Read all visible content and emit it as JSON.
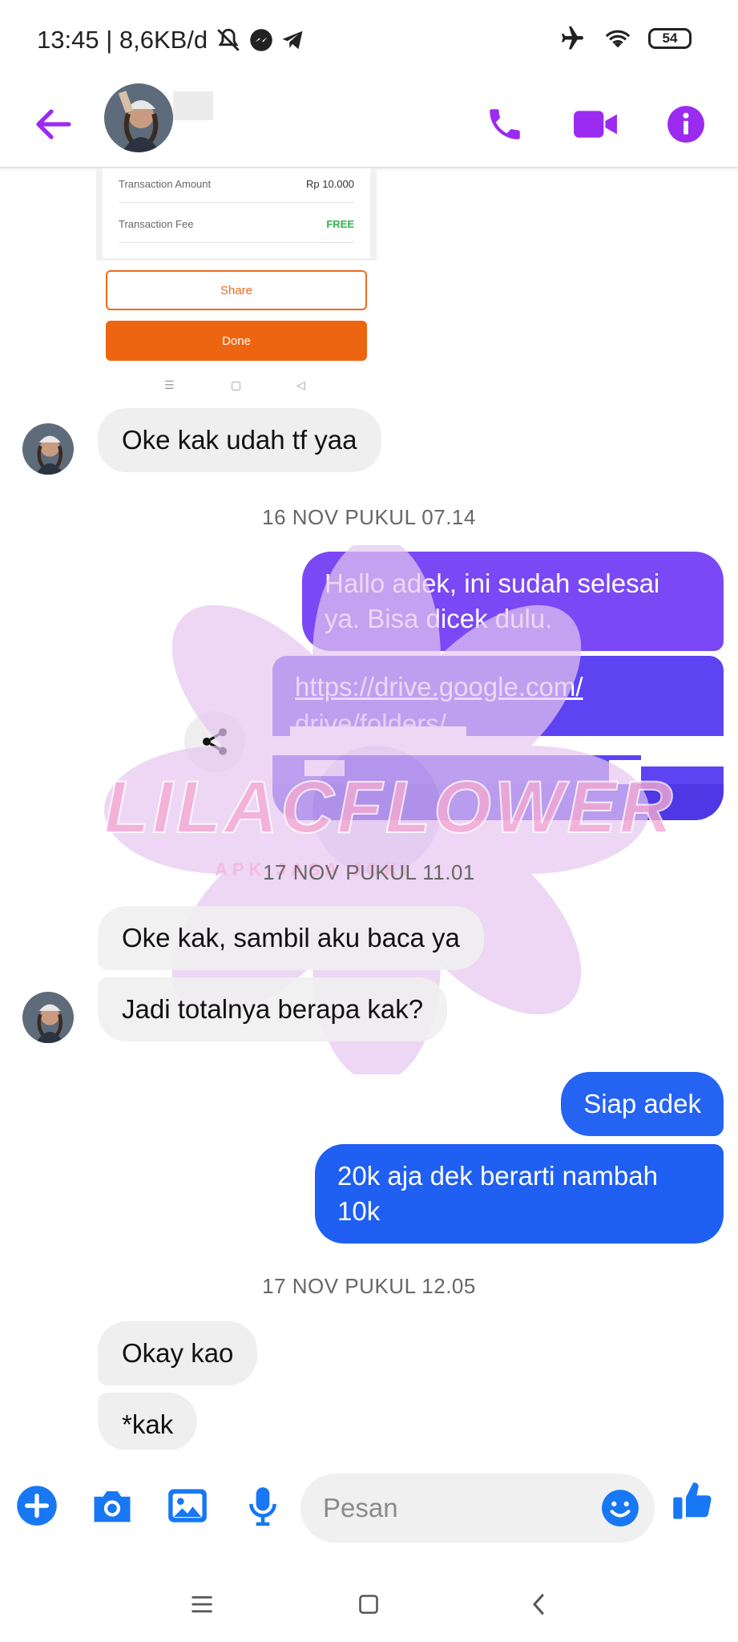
{
  "status_bar": {
    "time_speed": "13:45 | 8,6KB/d",
    "battery": "54"
  },
  "header": {
    "contact_name": "",
    "icons": [
      "back-arrow-icon",
      "phone-icon",
      "video-camera-icon",
      "info-icon"
    ],
    "accent_color": "#9b2bf0"
  },
  "receipt": {
    "rows": [
      {
        "label": "Transaction Amount",
        "value": "Rp 10.000"
      },
      {
        "label": "Transaction Fee",
        "value": "FREE"
      }
    ],
    "share_label": "Share",
    "done_label": "Done"
  },
  "messages": {
    "m1": "Oke kak udah tf yaa",
    "ts1": "16 NOV PUKUL 07.14",
    "m2": "Hallo adek, ini sudah selesai ya. Bisa dicek dulu.",
    "link_line1": "https://drive.google.com/",
    "link_line2": "drive/folders/",
    "ts2": "17 NOV PUKUL 11.01",
    "m3": "Oke kak, sambil aku baca ya",
    "m4": "Jadi totalnya berapa kak?",
    "m5": "Siap adek",
    "m6": "20k aja dek berarti nambah 10k",
    "ts3": "17 NOV PUKUL 12.05",
    "m7": "Okay kao",
    "m8": "*kak"
  },
  "watermark": {
    "title": "LILACFLOWER",
    "subtitle": "APK JASA JOKI"
  },
  "composer": {
    "placeholder": "Pesan",
    "icons": [
      "plus-icon",
      "camera-icon",
      "image-icon",
      "microphone-icon",
      "emoji-icon",
      "thumbs-up-icon"
    ]
  },
  "colors": {
    "purple_bubble": "#6b3ff5",
    "blue_bubble": "#1f5ff2",
    "incoming_bubble": "#efefef"
  }
}
